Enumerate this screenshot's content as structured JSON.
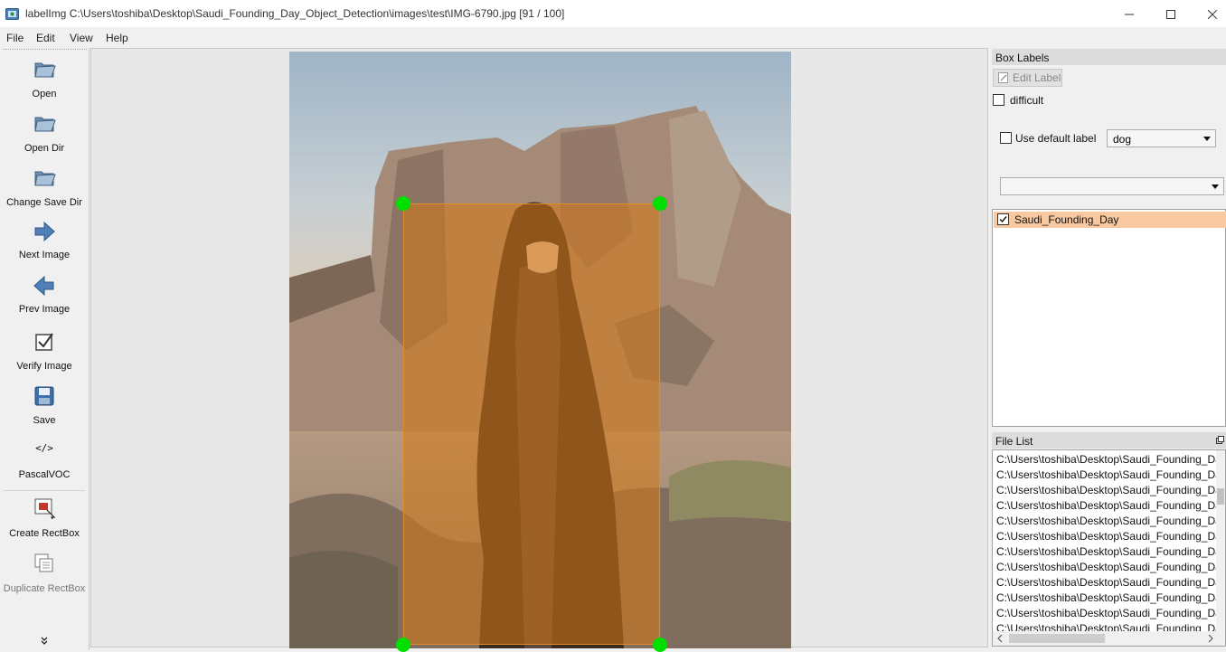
{
  "window": {
    "title": "labelImg C:\\Users\\toshiba\\Desktop\\Saudi_Founding_Day_Object_Detection\\images\\test\\IMG-6790.jpg [91 / 100]"
  },
  "menu": [
    "File",
    "Edit",
    "View",
    "Help"
  ],
  "toolbar": {
    "open": "Open",
    "open_dir": "Open Dir",
    "change_save_dir": "Change Save Dir",
    "next_image": "Next Image",
    "prev_image": "Prev Image",
    "verify_image": "Verify Image",
    "save": "Save",
    "format_icon_text": "</>",
    "format": "PascalVOC",
    "create_rectbox": "Create RectBox",
    "duplicate_rectbox": "Duplicate RectBox"
  },
  "box_labels": {
    "title": "Box Labels",
    "edit_label": "Edit Label",
    "difficult": "difficult",
    "use_default_label": "Use default label",
    "default_label_value": "dog",
    "filter_value": "",
    "labels": [
      {
        "text": "Saudi_Founding_Day",
        "checked": true
      }
    ]
  },
  "file_list": {
    "title": "File List",
    "items": [
      "C:\\Users\\toshiba\\Desktop\\Saudi_Founding_Da",
      "C:\\Users\\toshiba\\Desktop\\Saudi_Founding_Da",
      "C:\\Users\\toshiba\\Desktop\\Saudi_Founding_Da",
      "C:\\Users\\toshiba\\Desktop\\Saudi_Founding_Da",
      "C:\\Users\\toshiba\\Desktop\\Saudi_Founding_Da",
      "C:\\Users\\toshiba\\Desktop\\Saudi_Founding_Da",
      "C:\\Users\\toshiba\\Desktop\\Saudi_Founding_Da",
      "C:\\Users\\toshiba\\Desktop\\Saudi_Founding_Da",
      "C:\\Users\\toshiba\\Desktop\\Saudi_Founding_Da",
      "C:\\Users\\toshiba\\Desktop\\Saudi_Founding_Da",
      "C:\\Users\\toshiba\\Desktop\\Saudi_Founding_Da",
      "C:\\Users\\toshiba\\Desktop\\Saudi_Founding_Da"
    ]
  },
  "colors": {
    "box_fill": "#d67814",
    "handle": "#00e000",
    "selected_label_row": "#f8c9a0"
  }
}
